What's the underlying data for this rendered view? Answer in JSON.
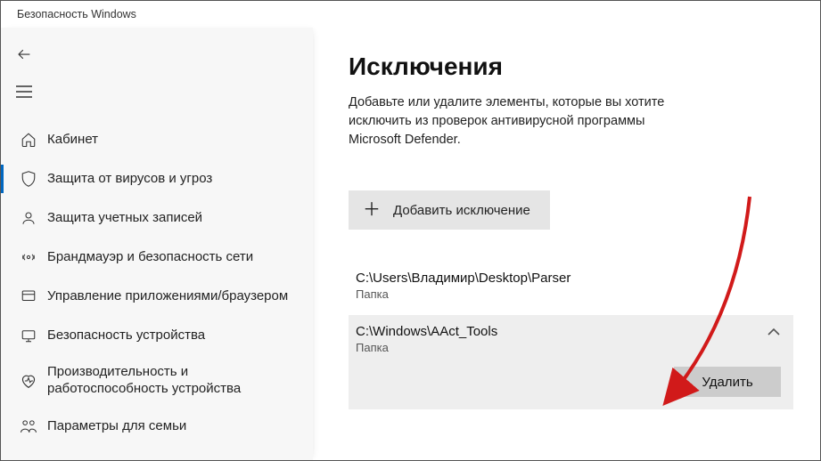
{
  "window": {
    "title": "Безопасность Windows"
  },
  "sidebar": {
    "items": [
      {
        "label": "Кабинет",
        "icon": "home-icon",
        "active": false
      },
      {
        "label": "Защита от вирусов и угроз",
        "icon": "shield-icon",
        "active": true
      },
      {
        "label": "Защита учетных записей",
        "icon": "person-icon",
        "active": false
      },
      {
        "label": "Брандмауэр и безопасность сети",
        "icon": "firewall-icon",
        "active": false
      },
      {
        "label": "Управление приложениями/браузером",
        "icon": "app-browser-icon",
        "active": false
      },
      {
        "label": "Безопасность устройства",
        "icon": "device-security-icon",
        "active": false
      },
      {
        "label": "Производительность и работоспособность устройства",
        "icon": "health-icon",
        "active": false,
        "tall": true
      },
      {
        "label": "Параметры для семьи",
        "icon": "family-icon",
        "active": false
      }
    ]
  },
  "page": {
    "title": "Исключения",
    "description": "Добавьте или удалите элементы, которые вы хотите исключить из проверок антивирусной программы Microsoft Defender.",
    "add_button": "Добавить исключение"
  },
  "exclusions": [
    {
      "path": "C:\\Users\\Владимир\\Desktop\\Parser",
      "kind": "Папка",
      "expanded": false
    },
    {
      "path": "C:\\Windows\\AAct_Tools",
      "kind": "Папка",
      "expanded": true
    }
  ],
  "actions": {
    "delete": "Удалить"
  },
  "colors": {
    "accent": "#0067c0",
    "panel": "#f7f7f7",
    "button": "#e5e5e5",
    "expanded": "#eeeeee",
    "delete_btn": "#cccccc",
    "arrow": "#d11a1a"
  }
}
